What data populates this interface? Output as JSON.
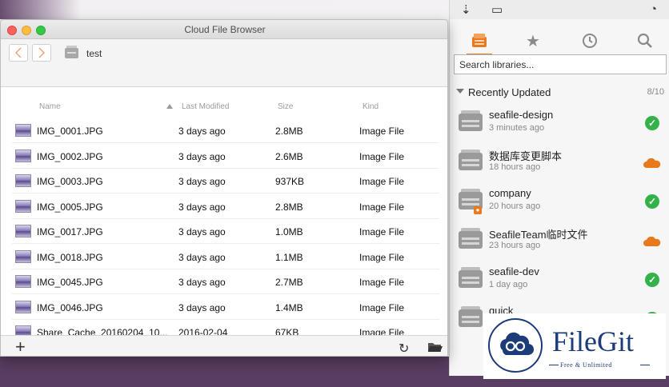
{
  "window": {
    "title": "Cloud File Browser",
    "breadcrumb": "test"
  },
  "columns": {
    "name": "Name",
    "modified": "Last Modified",
    "size": "Size",
    "kind": "Kind"
  },
  "files": [
    {
      "name": "IMG_0001.JPG",
      "modified": "3 days ago",
      "size": "2.8MB",
      "kind": "Image File"
    },
    {
      "name": "IMG_0002.JPG",
      "modified": "3 days ago",
      "size": "2.6MB",
      "kind": "Image File"
    },
    {
      "name": "IMG_0003.JPG",
      "modified": "3 days ago",
      "size": "937KB",
      "kind": "Image File"
    },
    {
      "name": "IMG_0005.JPG",
      "modified": "3 days ago",
      "size": "2.8MB",
      "kind": "Image File"
    },
    {
      "name": "IMG_0017.JPG",
      "modified": "3 days ago",
      "size": "1.0MB",
      "kind": "Image File"
    },
    {
      "name": "IMG_0018.JPG",
      "modified": "3 days ago",
      "size": "1.1MB",
      "kind": "Image File"
    },
    {
      "name": "IMG_0045.JPG",
      "modified": "3 days ago",
      "size": "2.7MB",
      "kind": "Image File"
    },
    {
      "name": "IMG_0046.JPG",
      "modified": "3 days ago",
      "size": "1.4MB",
      "kind": "Image File"
    },
    {
      "name": "Share_Cache_20160204_10...",
      "modified": "2016-02-04",
      "size": "67KB",
      "kind": "Image File"
    }
  ],
  "seafile": {
    "search_placeholder": "Search libraries...",
    "section_title": "Recently Updated",
    "section_count": "8/10",
    "libraries": [
      {
        "name": "seafile-design",
        "time": "3 minutes ago",
        "status": "synced",
        "locked": false
      },
      {
        "name": "数据库变更脚本",
        "time": "18 hours ago",
        "status": "cloud",
        "locked": false
      },
      {
        "name": "company",
        "time": "20 hours ago",
        "status": "synced",
        "locked": true
      },
      {
        "name": "SeafileTeam临时文件",
        "time": "23 hours ago",
        "status": "cloud",
        "locked": false
      },
      {
        "name": "seafile-dev",
        "time": "1 day ago",
        "status": "synced",
        "locked": false
      },
      {
        "name": "quick",
        "time": "",
        "status": "synced",
        "locked": false
      }
    ]
  },
  "watermark": {
    "name": "FileGit",
    "tagline": "Free & Unlimited"
  },
  "colors": {
    "accent": "#e8791c",
    "synced": "#34b24a",
    "brand": "#1b3c78"
  }
}
